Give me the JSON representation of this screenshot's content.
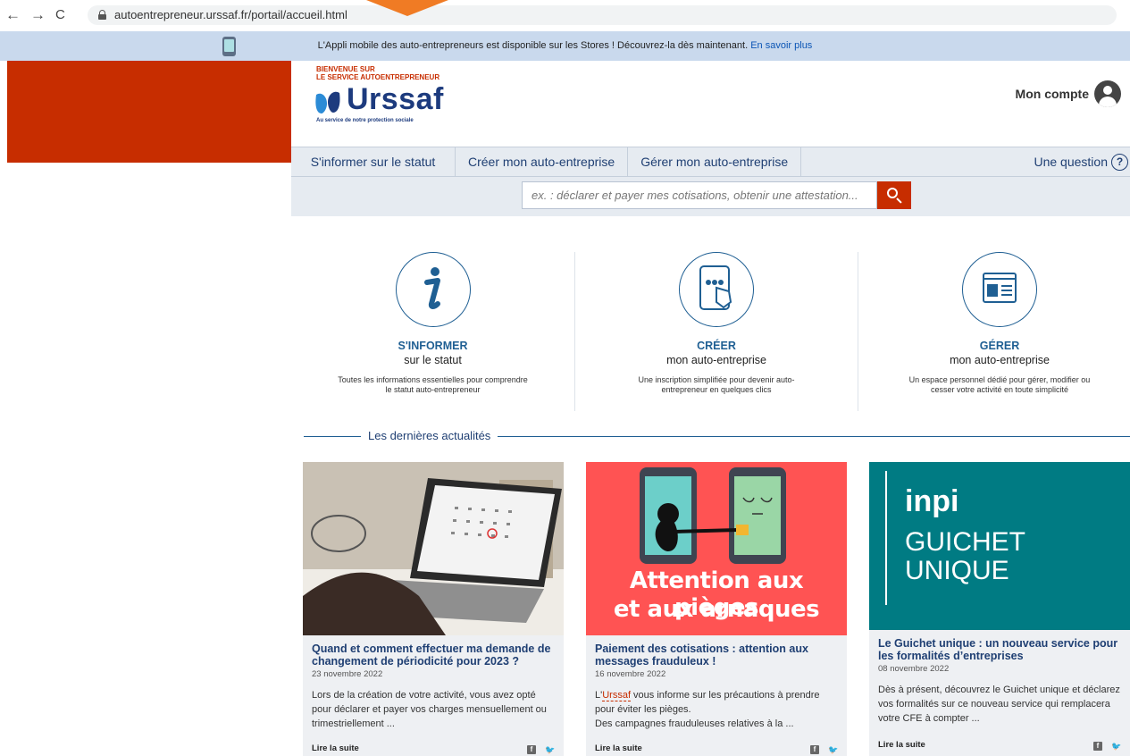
{
  "browser": {
    "url": "autoentrepreneur.urssaf.fr/portail/accueil.html",
    "back": "←",
    "forward": "→",
    "reload": "C"
  },
  "app_banner": {
    "text": "L'Appli mobile des auto-entrepreneurs est disponible sur les Stores ! Découvrez-la dès maintenant.",
    "link": "En savoir plus"
  },
  "header": {
    "welcome_line1": "BIENVENUE SUR",
    "welcome_line2": "LE SERVICE AUTOENTREPRENEUR",
    "logo_text": "Urssaf",
    "logo_sub": "Au service de notre protection sociale",
    "account_label": "Mon compte"
  },
  "nav": {
    "items": [
      {
        "label": "S'informer sur le statut"
      },
      {
        "label": "Créer mon auto-entreprise"
      },
      {
        "label": "Gérer mon auto-entreprise"
      }
    ],
    "question": "Une question",
    "question_mark": "?"
  },
  "search": {
    "placeholder": "ex. : déclarer et payer mes cotisations, obtenir une attestation..."
  },
  "pillars": [
    {
      "title": "S'INFORMER",
      "sub": "sur le statut",
      "desc": "Toutes les informations essentielles pour comprendre le statut auto-entrepreneur",
      "icon": "info-icon"
    },
    {
      "title": "CRÉER",
      "sub": "mon auto-entreprise",
      "desc": "Une inscription simplifiée pour devenir auto-entrepreneur en quelques clics",
      "icon": "tablet-touch-icon"
    },
    {
      "title": "GÉRER",
      "sub": "mon auto-entreprise",
      "desc": "Un espace personnel dédié pour gérer, modifier ou cesser votre activité en toute simplicité",
      "icon": "dashboard-icon"
    }
  ],
  "news": {
    "section_title": "Les dernières actualités",
    "read_more": "Lire la suite",
    "cards": [
      {
        "title": "Quand et comment effectuer ma demande de changement de périodicité pour 2023 ?",
        "date": "23 novembre 2022",
        "text": "Lors de la création de votre activité, vous avez opté pour déclarer et payer vos charges mensuellement ou trimestriellement ..."
      },
      {
        "title": "Paiement des cotisations : attention aux messages frauduleux !",
        "date": "16 novembre 2022",
        "text_prefix": "L'",
        "text_link": "Urssaf",
        "text_rest": " vous informe sur les précautions à prendre pour éviter les pièges.",
        "text_line2": "Des campagnes frauduleuses relatives à la ...",
        "image_caption_line1": "Attention aux pièges",
        "image_caption_line2": "et aux arnaques"
      },
      {
        "title": "Le Guichet unique : un nouveau service pour les formalités d’entreprises",
        "date": "08 novembre 2022",
        "text": "Dès à présent, découvrez le Guichet unique et déclarez vos formalités sur ce nouveau service qui remplacera votre CFE à compter ...",
        "image_brand": "inpi",
        "image_line1": "GUICHET",
        "image_line2": "UNIQUE"
      }
    ]
  },
  "colors": {
    "brand_red": "#c72d00",
    "brand_blue": "#1f3f73",
    "banner_bg": "#c9d9ed",
    "nav_bg": "#e6ebf1",
    "alert_red": "#ff5353",
    "inpi_teal": "#007b83"
  }
}
